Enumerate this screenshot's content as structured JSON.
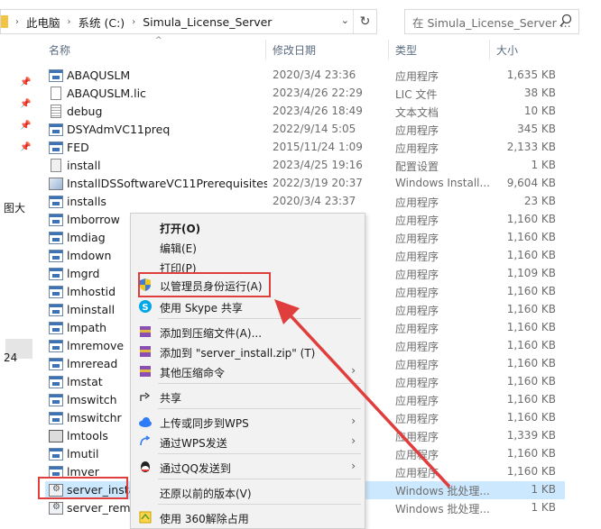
{
  "address": {
    "crumbs": [
      "此电脑",
      "系统 (C:)",
      "Simula_License_Server"
    ],
    "search_placeholder": "在 Simula_License_Server ..."
  },
  "nav": {
    "label_1": "图大",
    "label_2": "24"
  },
  "columns": {
    "name": "名称",
    "date": "修改日期",
    "type": "类型",
    "size": "大小"
  },
  "files": [
    {
      "name": "ABAQUSLM",
      "date": "2020/3/4 23:36",
      "type": "应用程序",
      "size": "1,635 KB",
      "icon": "exe"
    },
    {
      "name": "ABAQUSLM.lic",
      "date": "2023/4/26 22:29",
      "type": "LIC 文件",
      "size": "38 KB",
      "icon": "doc"
    },
    {
      "name": "debug",
      "date": "2023/4/26 18:49",
      "type": "文本文档",
      "size": "10 KB",
      "icon": "txt"
    },
    {
      "name": "DSYAdmVC11preq",
      "date": "2022/9/14 5:05",
      "type": "应用程序",
      "size": "345 KB",
      "icon": "exe"
    },
    {
      "name": "FED",
      "date": "2015/11/24 1:09",
      "type": "应用程序",
      "size": "2,133 KB",
      "icon": "exe"
    },
    {
      "name": "install",
      "date": "2023/4/25 19:16",
      "type": "配置设置",
      "size": "1 KB",
      "icon": "cfg"
    },
    {
      "name": "InstallDSSoftwareVC11Prerequisites_x...",
      "date": "2022/3/19 20:37",
      "type": "Windows Install...",
      "size": "9,604 KB",
      "icon": "msi"
    },
    {
      "name": "installs",
      "date": "2020/3/4 23:37",
      "type": "应用程序",
      "size": "23 KB",
      "icon": "exe"
    },
    {
      "name": "lmborrow",
      "date": "",
      "type": "应用程序",
      "size": "1,160 KB",
      "icon": "exe"
    },
    {
      "name": "lmdiag",
      "date": "",
      "type": "应用程序",
      "size": "1,160 KB",
      "icon": "exe"
    },
    {
      "name": "lmdown",
      "date": "",
      "type": "应用程序",
      "size": "1,160 KB",
      "icon": "exe"
    },
    {
      "name": "lmgrd",
      "date": "",
      "type": "应用程序",
      "size": "1,109 KB",
      "icon": "exe"
    },
    {
      "name": "lmhostid",
      "date": "",
      "type": "应用程序",
      "size": "1,160 KB",
      "icon": "exe"
    },
    {
      "name": "lminstall",
      "date": "",
      "type": "应用程序",
      "size": "1,160 KB",
      "icon": "exe"
    },
    {
      "name": "lmpath",
      "date": "",
      "type": "应用程序",
      "size": "1,160 KB",
      "icon": "exe"
    },
    {
      "name": "lmremove",
      "date": "",
      "type": "应用程序",
      "size": "1,160 KB",
      "icon": "exe"
    },
    {
      "name": "lmreread",
      "date": "",
      "type": "应用程序",
      "size": "1,160 KB",
      "icon": "exe"
    },
    {
      "name": "lmstat",
      "date": "",
      "type": "应用程序",
      "size": "1,160 KB",
      "icon": "exe"
    },
    {
      "name": "lmswitch",
      "date": "",
      "type": "应用程序",
      "size": "1,160 KB",
      "icon": "exe"
    },
    {
      "name": "lmswitchr",
      "date": "",
      "type": "应用程序",
      "size": "1,160 KB",
      "icon": "exe"
    },
    {
      "name": "lmtools",
      "date": "",
      "type": "应用程序",
      "size": "1,339 KB",
      "icon": "tool"
    },
    {
      "name": "lmutil",
      "date": "",
      "type": "应用程序",
      "size": "1,160 KB",
      "icon": "exe"
    },
    {
      "name": "lmver",
      "date": "",
      "type": "应用程序",
      "size": "1,160 KB",
      "icon": "exe"
    },
    {
      "name": "server_instal",
      "date": "",
      "type": "Windows 批处理...",
      "size": "1 KB",
      "icon": "bat"
    },
    {
      "name": "server_remo",
      "date": "",
      "type": "Windows 批处理...",
      "size": "1 KB",
      "icon": "bat"
    }
  ],
  "context_menu": {
    "open": "打开(O)",
    "edit": "编辑(E)",
    "print": "打印(P)",
    "run_as_admin": "以管理员身份运行(A)",
    "skype": "使用 Skype 共享",
    "add_archive": "添加到压缩文件(A)...",
    "add_zip": "添加到 \"server_install.zip\" (T)",
    "other_compress": "其他压缩命令",
    "share": "共享",
    "wps_upload": "上传或同步到WPS",
    "wps_send": "通过WPS发送",
    "qq_send": "通过QQ发送到",
    "restore": "还原以前的版本(V)",
    "unlock_360": "使用 360解除占用"
  },
  "colors": {
    "highlight": "#e03d3d",
    "selection": "#cce8ff"
  }
}
